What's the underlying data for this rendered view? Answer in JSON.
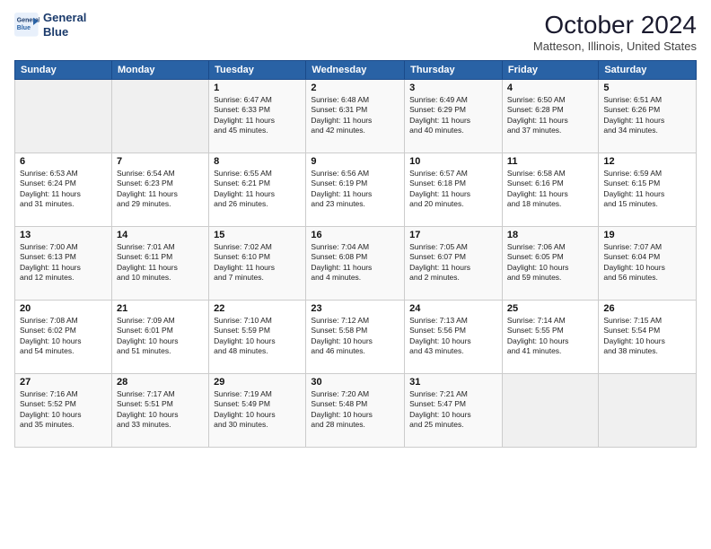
{
  "header": {
    "logo_line1": "General",
    "logo_line2": "Blue",
    "title": "October 2024",
    "subtitle": "Matteson, Illinois, United States"
  },
  "days_of_week": [
    "Sunday",
    "Monday",
    "Tuesday",
    "Wednesday",
    "Thursday",
    "Friday",
    "Saturday"
  ],
  "weeks": [
    [
      {
        "day": "",
        "info": ""
      },
      {
        "day": "",
        "info": ""
      },
      {
        "day": "1",
        "info": "Sunrise: 6:47 AM\nSunset: 6:33 PM\nDaylight: 11 hours\nand 45 minutes."
      },
      {
        "day": "2",
        "info": "Sunrise: 6:48 AM\nSunset: 6:31 PM\nDaylight: 11 hours\nand 42 minutes."
      },
      {
        "day": "3",
        "info": "Sunrise: 6:49 AM\nSunset: 6:29 PM\nDaylight: 11 hours\nand 40 minutes."
      },
      {
        "day": "4",
        "info": "Sunrise: 6:50 AM\nSunset: 6:28 PM\nDaylight: 11 hours\nand 37 minutes."
      },
      {
        "day": "5",
        "info": "Sunrise: 6:51 AM\nSunset: 6:26 PM\nDaylight: 11 hours\nand 34 minutes."
      }
    ],
    [
      {
        "day": "6",
        "info": "Sunrise: 6:53 AM\nSunset: 6:24 PM\nDaylight: 11 hours\nand 31 minutes."
      },
      {
        "day": "7",
        "info": "Sunrise: 6:54 AM\nSunset: 6:23 PM\nDaylight: 11 hours\nand 29 minutes."
      },
      {
        "day": "8",
        "info": "Sunrise: 6:55 AM\nSunset: 6:21 PM\nDaylight: 11 hours\nand 26 minutes."
      },
      {
        "day": "9",
        "info": "Sunrise: 6:56 AM\nSunset: 6:19 PM\nDaylight: 11 hours\nand 23 minutes."
      },
      {
        "day": "10",
        "info": "Sunrise: 6:57 AM\nSunset: 6:18 PM\nDaylight: 11 hours\nand 20 minutes."
      },
      {
        "day": "11",
        "info": "Sunrise: 6:58 AM\nSunset: 6:16 PM\nDaylight: 11 hours\nand 18 minutes."
      },
      {
        "day": "12",
        "info": "Sunrise: 6:59 AM\nSunset: 6:15 PM\nDaylight: 11 hours\nand 15 minutes."
      }
    ],
    [
      {
        "day": "13",
        "info": "Sunrise: 7:00 AM\nSunset: 6:13 PM\nDaylight: 11 hours\nand 12 minutes."
      },
      {
        "day": "14",
        "info": "Sunrise: 7:01 AM\nSunset: 6:11 PM\nDaylight: 11 hours\nand 10 minutes."
      },
      {
        "day": "15",
        "info": "Sunrise: 7:02 AM\nSunset: 6:10 PM\nDaylight: 11 hours\nand 7 minutes."
      },
      {
        "day": "16",
        "info": "Sunrise: 7:04 AM\nSunset: 6:08 PM\nDaylight: 11 hours\nand 4 minutes."
      },
      {
        "day": "17",
        "info": "Sunrise: 7:05 AM\nSunset: 6:07 PM\nDaylight: 11 hours\nand 2 minutes."
      },
      {
        "day": "18",
        "info": "Sunrise: 7:06 AM\nSunset: 6:05 PM\nDaylight: 10 hours\nand 59 minutes."
      },
      {
        "day": "19",
        "info": "Sunrise: 7:07 AM\nSunset: 6:04 PM\nDaylight: 10 hours\nand 56 minutes."
      }
    ],
    [
      {
        "day": "20",
        "info": "Sunrise: 7:08 AM\nSunset: 6:02 PM\nDaylight: 10 hours\nand 54 minutes."
      },
      {
        "day": "21",
        "info": "Sunrise: 7:09 AM\nSunset: 6:01 PM\nDaylight: 10 hours\nand 51 minutes."
      },
      {
        "day": "22",
        "info": "Sunrise: 7:10 AM\nSunset: 5:59 PM\nDaylight: 10 hours\nand 48 minutes."
      },
      {
        "day": "23",
        "info": "Sunrise: 7:12 AM\nSunset: 5:58 PM\nDaylight: 10 hours\nand 46 minutes."
      },
      {
        "day": "24",
        "info": "Sunrise: 7:13 AM\nSunset: 5:56 PM\nDaylight: 10 hours\nand 43 minutes."
      },
      {
        "day": "25",
        "info": "Sunrise: 7:14 AM\nSunset: 5:55 PM\nDaylight: 10 hours\nand 41 minutes."
      },
      {
        "day": "26",
        "info": "Sunrise: 7:15 AM\nSunset: 5:54 PM\nDaylight: 10 hours\nand 38 minutes."
      }
    ],
    [
      {
        "day": "27",
        "info": "Sunrise: 7:16 AM\nSunset: 5:52 PM\nDaylight: 10 hours\nand 35 minutes."
      },
      {
        "day": "28",
        "info": "Sunrise: 7:17 AM\nSunset: 5:51 PM\nDaylight: 10 hours\nand 33 minutes."
      },
      {
        "day": "29",
        "info": "Sunrise: 7:19 AM\nSunset: 5:49 PM\nDaylight: 10 hours\nand 30 minutes."
      },
      {
        "day": "30",
        "info": "Sunrise: 7:20 AM\nSunset: 5:48 PM\nDaylight: 10 hours\nand 28 minutes."
      },
      {
        "day": "31",
        "info": "Sunrise: 7:21 AM\nSunset: 5:47 PM\nDaylight: 10 hours\nand 25 minutes."
      },
      {
        "day": "",
        "info": ""
      },
      {
        "day": "",
        "info": ""
      }
    ]
  ]
}
